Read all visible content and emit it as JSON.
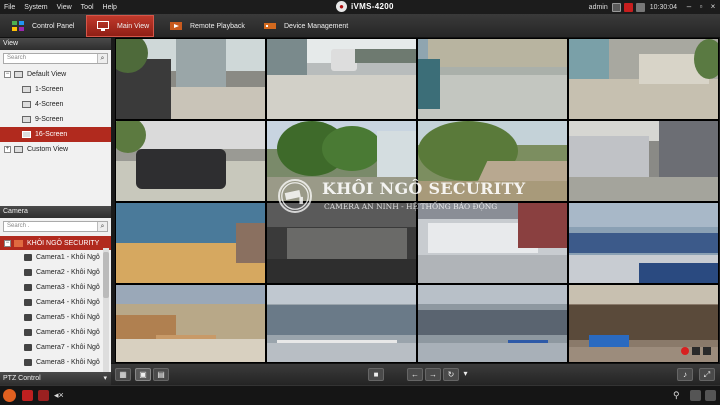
{
  "menubar": {
    "items": [
      "File",
      "System",
      "View",
      "Tool",
      "Help"
    ],
    "app_title": "iVMS-4200",
    "user": "admin",
    "time": "10:30:04"
  },
  "tabs": [
    {
      "label": "Control Panel",
      "icon": "grid-icon"
    },
    {
      "label": "Main View",
      "icon": "monitor-icon"
    },
    {
      "label": "Remote Playback",
      "icon": "playback-icon"
    },
    {
      "label": "Device Management",
      "icon": "device-icon"
    }
  ],
  "view_panel": {
    "title": "View",
    "search_placeholder": "Search",
    "tree": [
      {
        "label": "Default View"
      },
      {
        "label": "1-Screen"
      },
      {
        "label": "4-Screen"
      },
      {
        "label": "9-Screen"
      },
      {
        "label": "16-Screen"
      },
      {
        "label": "Custom View"
      }
    ]
  },
  "camera_panel": {
    "title": "Camera",
    "search_placeholder": "Search .",
    "group": "KHÔI NGÔ SECURITY",
    "cameras": [
      "Camera1 - Khôi Ngô",
      "Camera2 - Khôi Ngô",
      "Camera3 - Khôi Ngô",
      "Camera4 - Khôi Ngô",
      "Camera5 - Khôi Ngô",
      "Camera6 - Khôi Ngô",
      "Camera7 - Khôi Ngô",
      "Camera8 - Khôi Ngô"
    ]
  },
  "ptz_panel": {
    "title": "PTZ Control"
  },
  "watermark": {
    "title": "KHÔI NGÔ SECURITY",
    "subtitle": "CAMERA AN NINH - HỆ THỐNG BÁO ĐỘNG"
  },
  "colors": {
    "accent": "#b12a1e",
    "panel_bg": "#f1f1f1",
    "toolbar_bg": "#2b2b2b"
  }
}
